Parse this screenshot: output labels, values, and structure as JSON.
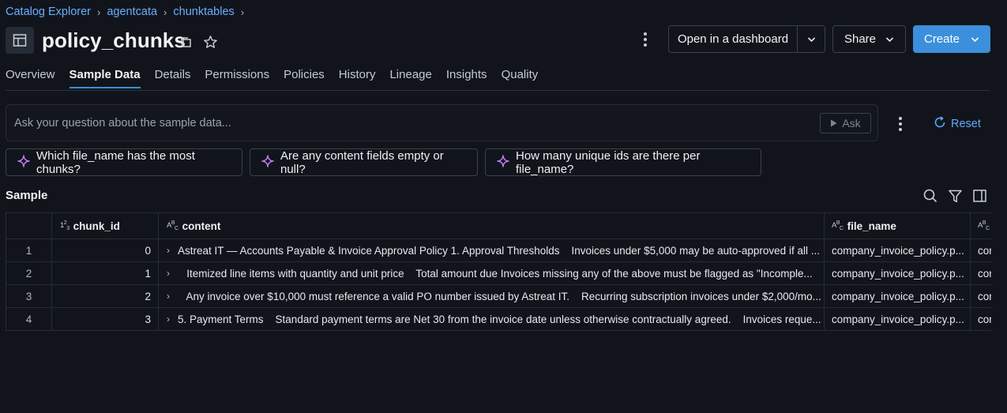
{
  "breadcrumb": [
    "Catalog Explorer",
    "agentcata",
    "chunktables"
  ],
  "title": "policy_chunks",
  "header": {
    "open_dashboard": "Open in a dashboard",
    "share": "Share",
    "create": "Create"
  },
  "tabs": [
    "Overview",
    "Sample Data",
    "Details",
    "Permissions",
    "Policies",
    "History",
    "Lineage",
    "Insights",
    "Quality"
  ],
  "active_tab": "Sample Data",
  "ask": {
    "placeholder": "Ask your question about the sample data...",
    "ask_label": "Ask",
    "reset_label": "Reset"
  },
  "suggestions": [
    "Which file_name has the most chunks?",
    "Are any content fields empty or null?",
    "How many unique ids are there per file_name?"
  ],
  "sample_label": "Sample",
  "table": {
    "columns": [
      {
        "type": "123",
        "name": "chunk_id"
      },
      {
        "type": "ABC",
        "name": "content"
      },
      {
        "type": "ABC",
        "name": "file_name"
      },
      {
        "type": "ABC",
        "name": ""
      }
    ],
    "rows": [
      {
        "index": "1",
        "chunk_id": "0",
        "content": "Astreat IT — Accounts Payable & Invoice Approval Policy 1. Approval Thresholds    Invoices under $5,000 may be auto-approved if all ...",
        "file_name": "company_invoice_policy.p...",
        "extra": "cor"
      },
      {
        "index": "2",
        "chunk_id": "1",
        "content": "   Itemized line items with quantity and unit price    Total amount due Invoices missing any of the above must be flagged as \"Incomple...",
        "file_name": "company_invoice_policy.p...",
        "extra": "cor"
      },
      {
        "index": "3",
        "chunk_id": "2",
        "content": "   Any invoice over $10,000 must reference a valid PO number issued by Astreat IT.    Recurring subscription invoices under $2,000/mo...",
        "file_name": "company_invoice_policy.p...",
        "extra": "cor"
      },
      {
        "index": "4",
        "chunk_id": "3",
        "content": "5. Payment Terms    Standard payment terms are Net 30 from the invoice date unless otherwise contractually agreed.    Invoices reque...",
        "file_name": "company_invoice_policy.p...",
        "extra": "cor"
      }
    ]
  },
  "colors": {
    "background": "#11151b",
    "accent": "#3b8fdc",
    "link": "#6aaeff",
    "sparkle": "#c77dff"
  }
}
